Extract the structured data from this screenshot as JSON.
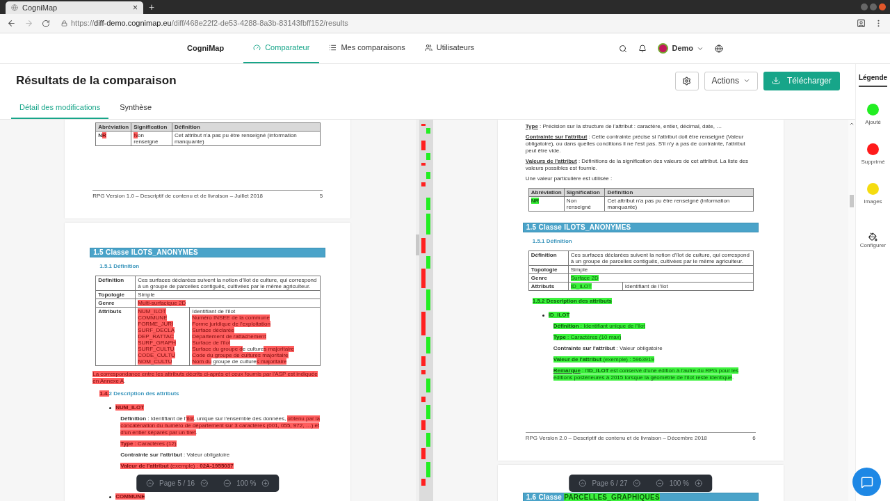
{
  "browser": {
    "tab_title": "CogniMap",
    "new_tab": "+",
    "close": "×",
    "url_scheme": "https://",
    "url_host": "diff-demo.cognimap.eu",
    "url_path": "/diff/468e22f2-de53-4288-8a3b-83143fbff152/results"
  },
  "nav": {
    "brand": "CogniMap",
    "items": [
      {
        "label": "Comparateur",
        "selected": true
      },
      {
        "label": "Mes comparaisons",
        "selected": false
      },
      {
        "label": "Utilisateurs",
        "selected": false
      }
    ],
    "user": "Demo"
  },
  "header": {
    "title": "Résultats de la comparaison",
    "actions": "Actions",
    "download": "Télécharger"
  },
  "tabs": [
    {
      "label": "Détail des modifications",
      "selected": true
    },
    {
      "label": "Synthèse",
      "selected": false
    }
  ],
  "legend": {
    "title": "Légende",
    "items": [
      {
        "label": "Ajouté",
        "color": "#22ee22"
      },
      {
        "label": "Supprimé",
        "color": "#ff1a1a"
      },
      {
        "label": "Images",
        "color": "#f5dc10"
      }
    ],
    "configure": "Configurer"
  },
  "left_document": {
    "page_label": "Page 5 / 16",
    "zoom": "100 %",
    "pages": [
      {
        "blocks": [
          {
            "kind": "table",
            "rows": [
              {
                "header": true,
                "cells": [
                  {
                    "lines": [
                      [
                        {
                          "text": "Abréviation",
                          "kind": "plain"
                        }
                      ]
                    ]
                  },
                  {
                    "lines": [
                      [
                        {
                          "text": "Signification",
                          "kind": "plain"
                        }
                      ]
                    ]
                  },
                  {
                    "lines": [
                      [
                        {
                          "text": "Définition",
                          "kind": "plain"
                        }
                      ]
                    ]
                  }
                ]
              },
              {
                "header": false,
                "cells": [
                  {
                    "lines": [
                      [
                        {
                          "text": "**N**",
                          "kind": "plain"
                        },
                        {
                          "text": "**R**",
                          "kind": "deleted"
                        }
                      ]
                    ]
                  },
                  {
                    "lines": [
                      [
                        {
                          "text": "N",
                          "kind": "deleted"
                        },
                        {
                          "text": "on renseigné",
                          "kind": "plain"
                        }
                      ]
                    ]
                  },
                  {
                    "lines": [
                      [
                        {
                          "text": "Cet attribut n'a pas pu être renseigné (information manquante)",
                          "kind": "plain"
                        }
                      ]
                    ]
                  }
                ]
              }
            ]
          },
          {
            "kind": "footer",
            "text": "RPG Version 1.0 – Descriptif de contenu et de livraison – Juillet 2018",
            "page": "5"
          }
        ]
      },
      {
        "blocks": [
          {
            "kind": "heading",
            "segments": [
              {
                "text": "1.5 Classe ILOTS_ANONYMES",
                "kind": "plain"
              }
            ]
          },
          {
            "kind": "subheading",
            "segments": [
              {
                "text": "1.5.1 Définition",
                "kind": "plain"
              }
            ]
          },
          {
            "kind": "table",
            "rows": [
              {
                "header": false,
                "cells": [
                  {
                    "lines": [
                      [
                        {
                          "text": "**Définition**",
                          "kind": "plain"
                        }
                      ]
                    ]
                  },
                  {
                    "lines": [
                      [
                        {
                          "text": "Ces surfaces déclarées suivent la notion d'îlot de culture, qui correspond à un groupe de parcelles contiguës, cultivées par le même agriculteur.",
                          "kind": "plain"
                        }
                      ]
                    ]
                  }
                ]
              },
              {
                "header": false,
                "cells": [
                  {
                    "lines": [
                      [
                        {
                          "text": "**Topologie**",
                          "kind": "plain"
                        }
                      ]
                    ]
                  },
                  {
                    "lines": [
                      [
                        {
                          "text": "Simple",
                          "kind": "plain"
                        }
                      ]
                    ]
                  }
                ]
              },
              {
                "header": false,
                "cells": [
                  {
                    "lines": [
                      [
                        {
                          "text": "**Genre**",
                          "kind": "plain"
                        }
                      ]
                    ]
                  },
                  {
                    "lines": [
                      [
                        {
                          "text": "Multi-surfacique 2D",
                          "kind": "deleted"
                        }
                      ]
                    ]
                  }
                ]
              },
              {
                "header": false,
                "cells": [
                  {
                    "lines": [
                      [
                        {
                          "text": "**Attributs**",
                          "kind": "plain"
                        }
                      ]
                    ]
                  },
                  {
                    "columns": [
                      {
                        "lines": [
                          [
                            {
                              "text": "NUM_ILOT",
                              "kind": "deleted"
                            }
                          ],
                          [
                            {
                              "text": "COMMUNE",
                              "kind": "deleted"
                            }
                          ],
                          [
                            {
                              "text": "FORME_JURI",
                              "kind": "deleted"
                            }
                          ],
                          [
                            {
                              "text": "SURF_DECLA",
                              "kind": "deleted"
                            }
                          ],
                          [
                            {
                              "text": "DEP_RATTAC",
                              "kind": "deleted"
                            }
                          ],
                          [
                            {
                              "text": "SURF_GRAPH",
                              "kind": "deleted"
                            }
                          ],
                          [
                            {
                              "text": "SURF_CULTU",
                              "kind": "deleted"
                            }
                          ],
                          [
                            {
                              "text": "CODE_CULTU",
                              "kind": "deleted"
                            }
                          ],
                          [
                            {
                              "text": "NOM_CULTU",
                              "kind": "deleted"
                            }
                          ]
                        ]
                      },
                      {
                        "lines": [
                          [
                            {
                              "text": "Identifiant de l'îlot",
                              "kind": "plain"
                            }
                          ],
                          [
                            {
                              "text": "Numéro INSEE de la commune",
                              "kind": "deleted"
                            }
                          ],
                          [
                            {
                              "text": "Forme juridique de l'exploitation",
                              "kind": "deleted"
                            }
                          ],
                          [
                            {
                              "text": "Surface déclarée",
                              "kind": "deleted"
                            }
                          ],
                          [
                            {
                              "text": "Département de rattachement",
                              "kind": "deleted"
                            }
                          ],
                          [
                            {
                              "text": "Surface de l'îlot",
                              "kind": "deleted"
                            }
                          ],
                          [
                            {
                              "text": "Surface du groupe d",
                              "kind": "deleted"
                            },
                            {
                              "text": "e culture",
                              "kind": "plain"
                            },
                            {
                              "text": "s majoritaire",
                              "kind": "deleted"
                            }
                          ],
                          [
                            {
                              "text": "Code du groupe de cultures majoritaire",
                              "kind": "deleted"
                            }
                          ],
                          [
                            {
                              "text": "Nom du",
                              "kind": "deleted"
                            },
                            {
                              "text": " groupe de culture",
                              "kind": "plain"
                            },
                            {
                              "text": "s majoritaire",
                              "kind": "deleted"
                            }
                          ]
                        ]
                      }
                    ]
                  }
                ]
              }
            ]
          },
          {
            "kind": "paragraph",
            "segments": [
              {
                "text": "La correspondance entre les attributs décrits ci-après et ceux fournis par l'ASP est indiquée en Annexe A",
                "kind": "deleted"
              },
              {
                "text": ".",
                "kind": "plain"
              }
            ]
          },
          {
            "kind": "subheading",
            "segments": [
              {
                "text": "1.4.",
                "kind": "deleted"
              },
              {
                "text": "2 Description des attributs",
                "kind": "plain"
              }
            ]
          },
          {
            "kind": "bullet",
            "segments": [
              {
                "text": "NUM_ILOT",
                "kind": "deleted"
              }
            ]
          },
          {
            "kind": "detail",
            "segments": [
              {
                "text": "**Définition** : Identifiant de l'",
                "kind": "plain"
              },
              {
                "text": "îlot",
                "kind": "deleted"
              },
              {
                "text": ", unique sur l'ensemble des données, ",
                "kind": "plain"
              },
              {
                "text": "obtenu par la concaténation du numéro de département sur 3 caractères (001, 055, 972, …) et d'un entier séparés par un tiret",
                "kind": "deleted"
              },
              {
                "text": ".",
                "kind": "plain"
              }
            ]
          },
          {
            "kind": "detail",
            "segments": [
              {
                "text": "**Type** : Caractères (12)",
                "kind": "deleted"
              }
            ]
          },
          {
            "kind": "detail",
            "segments": [
              {
                "text": "**Contrainte sur l'attribut** : Valeur obligatoire",
                "kind": "plain"
              }
            ]
          },
          {
            "kind": "detail",
            "segments": [
              {
                "text": "**Valeur de l'attribut** (exemple) : **02A-1955037**",
                "kind": "deleted"
              }
            ]
          },
          {
            "kind": "bullet",
            "segments": [
              {
                "text": "COMMUNE",
                "kind": "deleted"
              }
            ]
          }
        ]
      }
    ]
  },
  "right_document": {
    "page_label": "Page 6 / 27",
    "zoom": "100 %",
    "pages": [
      {
        "blocks": [
          {
            "kind": "paragraph",
            "lead": {
              "text": "Type",
              "kind": "plain"
            },
            "segments": [
              {
                "text": " : Précision sur la structure de l'attribut : caractère, entier, décimal, date, …",
                "kind": "plain"
              }
            ]
          },
          {
            "kind": "paragraph",
            "lead": {
              "text": "Contrainte sur l'attribut",
              "kind": "plain"
            },
            "segments": [
              {
                "text": " : Cette contrainte précise si l'attribut doit être renseigné (Valeur obligatoire), ou dans quelles conditions il ne l'est pas. S'il n'y a pas de contrainte, l'attribut peut être vide.",
                "kind": "plain"
              }
            ]
          },
          {
            "kind": "paragraph",
            "lead": {
              "text": "Valeurs de l'attribut",
              "kind": "plain"
            },
            "segments": [
              {
                "text": " : Définitions de la signification des valeurs de cet attribut. La liste des valeurs possibles est fournie.",
                "kind": "plain"
              }
            ]
          },
          {
            "kind": "paragraph",
            "segments": [
              {
                "text": "Une valeur particulière est utilisée :",
                "kind": "plain"
              }
            ]
          },
          {
            "kind": "table",
            "rows": [
              {
                "header": true,
                "cells": [
                  {
                    "lines": [
                      [
                        {
                          "text": "Abréviation",
                          "kind": "plain"
                        }
                      ]
                    ]
                  },
                  {
                    "lines": [
                      [
                        {
                          "text": "Signification",
                          "kind": "plain"
                        }
                      ]
                    ]
                  },
                  {
                    "lines": [
                      [
                        {
                          "text": "Définition",
                          "kind": "plain"
                        }
                      ]
                    ]
                  }
                ]
              },
              {
                "header": false,
                "cells": [
                  {
                    "lines": [
                      [
                        {
                          "text": "**NR**",
                          "kind": "added"
                        }
                      ]
                    ]
                  },
                  {
                    "lines": [
                      [
                        {
                          "text": "Non renseigné",
                          "kind": "plain"
                        }
                      ]
                    ]
                  },
                  {
                    "lines": [
                      [
                        {
                          "text": "Cet attribut n'a pas pu être renseigné (information manquante)",
                          "kind": "plain"
                        }
                      ]
                    ]
                  }
                ]
              }
            ]
          },
          {
            "kind": "heading",
            "segments": [
              {
                "text": "1.5 Classe ILOTS_ANONYMES",
                "kind": "plain"
              }
            ]
          },
          {
            "kind": "subheading",
            "segments": [
              {
                "text": "1.5.1 Définition",
                "kind": "plain"
              }
            ]
          },
          {
            "kind": "table",
            "rows": [
              {
                "header": false,
                "cells": [
                  {
                    "lines": [
                      [
                        {
                          "text": "**Définition**",
                          "kind": "plain"
                        }
                      ]
                    ]
                  },
                  {
                    "lines": [
                      [
                        {
                          "text": "Ces surfaces déclarées suivent la notion d'îlot de culture, qui correspond à un groupe de parcelles contiguës, cultivées par le même agriculteur.",
                          "kind": "plain"
                        }
                      ]
                    ]
                  }
                ]
              },
              {
                "header": false,
                "cells": [
                  {
                    "lines": [
                      [
                        {
                          "text": "**Topologie**",
                          "kind": "plain"
                        }
                      ]
                    ]
                  },
                  {
                    "lines": [
                      [
                        {
                          "text": "Simple",
                          "kind": "plain"
                        }
                      ]
                    ]
                  }
                ]
              },
              {
                "header": false,
                "cells": [
                  {
                    "lines": [
                      [
                        {
                          "text": "**Genre**",
                          "kind": "plain"
                        }
                      ]
                    ]
                  },
                  {
                    "lines": [
                      [
                        {
                          "text": "Surface 2D",
                          "kind": "added"
                        }
                      ]
                    ]
                  }
                ]
              },
              {
                "header": false,
                "cells": [
                  {
                    "lines": [
                      [
                        {
                          "text": "**Attributs**",
                          "kind": "plain"
                        }
                      ]
                    ]
                  },
                  {
                    "columns": [
                      {
                        "lines": [
                          [
                            {
                              "text": "ID_ILOT",
                              "kind": "added"
                            }
                          ]
                        ]
                      },
                      {
                        "lines": [
                          [
                            {
                              "text": "Identifiant de l'îlot",
                              "kind": "plain"
                            }
                          ]
                        ]
                      }
                    ]
                  }
                ]
              }
            ]
          },
          {
            "kind": "subheading",
            "segments": [
              {
                "text": "1.5.2 Description des attributs",
                "kind": "added"
              }
            ]
          },
          {
            "kind": "bullet",
            "segments": [
              {
                "text": "ID_ILOT",
                "kind": "added"
              }
            ]
          },
          {
            "kind": "detail",
            "segments": [
              {
                "text": "**Définition** : Identifiant unique de l'îlot",
                "kind": "added"
              }
            ]
          },
          {
            "kind": "detail",
            "segments": [
              {
                "text": "**Type** : Caractères (10 max)",
                "kind": "added"
              }
            ]
          },
          {
            "kind": "detail",
            "segments": [
              {
                "text": "**Contrainte sur l'attribut** : Valeur obligatoire",
                "kind": "plain"
              }
            ]
          },
          {
            "kind": "detail",
            "segments": [
              {
                "text": "**Valeur de l'attribut** (exemple) : 5963919",
                "kind": "added"
              }
            ]
          },
          {
            "kind": "detail",
            "lead": {
              "text": "Remarque",
              "kind": "added"
            },
            "segments": [
              {
                "text": " : l'**ID_ILOT** est conservé d'une édition à l'autre du RPG pour les éditions postérieures à 2015 lorsque la géométrie de l'îlot reste identique",
                "kind": "added"
              },
              {
                "text": ".",
                "kind": "plain"
              }
            ]
          },
          {
            "kind": "footer",
            "text": "RPG Version 2.0 – Descriptif de contenu et de livraison – Décembre 2018",
            "page": "6"
          }
        ]
      },
      {
        "blocks": [
          {
            "kind": "heading",
            "segments": [
              {
                "text": "1.6 Classe ",
                "kind": "plain"
              },
              {
                "text": "PARCELLES_GRAPHIQUES",
                "kind": "added"
              }
            ]
          }
        ]
      }
    ]
  }
}
